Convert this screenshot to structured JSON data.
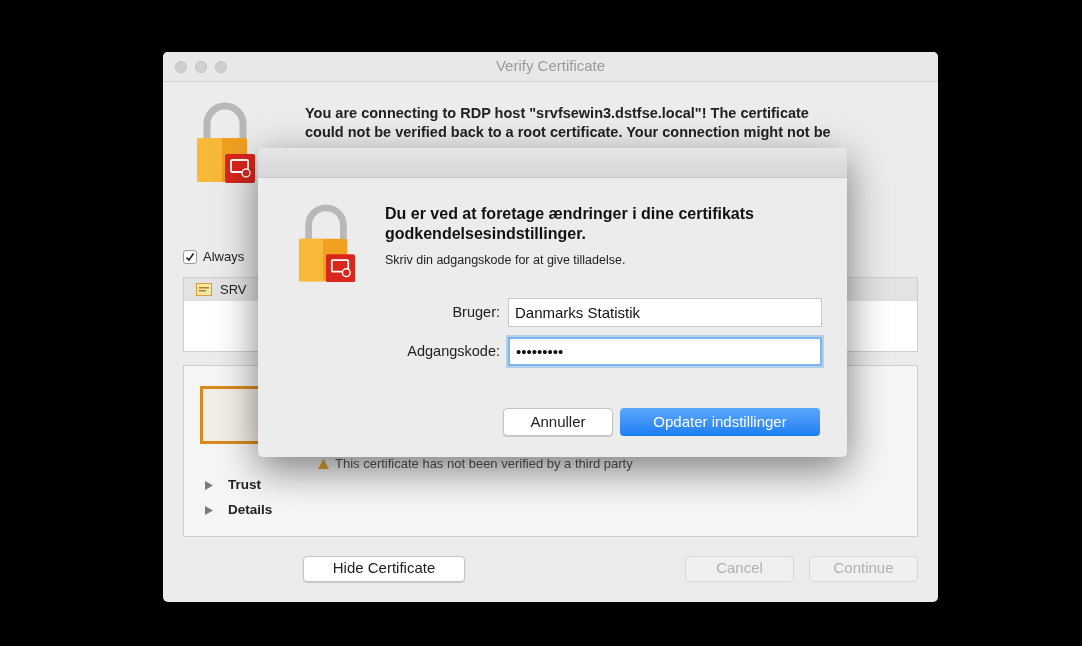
{
  "window": {
    "title": "Verify Certificate"
  },
  "message_lines": [
    "You are connecting to RDP host \"srvfsewin3.dstfse.local\"! The certificate",
    "could not be verified back to a root certificate. Your connection might not be"
  ],
  "always_checkbox": {
    "label": "Always",
    "checked": true
  },
  "certificate_list": [
    {
      "label": "SRV",
      "selected": true
    }
  ],
  "certificate_panel": {
    "warning": "This certificate has not been verified by a third party",
    "disclosures": [
      {
        "label": "Trust",
        "expanded": false
      },
      {
        "label": "Details",
        "expanded": false
      }
    ]
  },
  "buttons": [
    {
      "label": "Hide Certificate",
      "disabled": false
    },
    {
      "label": "Cancel",
      "disabled": true
    },
    {
      "label": "Continue",
      "disabled": true
    }
  ],
  "dialog": {
    "heading": "Du er ved at foretage ændringer i dine certifikats godkendelsesindstillinger.",
    "subtext": "Skriv din adgangskode for at give tilladelse.",
    "fields": [
      {
        "label": "Bruger:",
        "value": "Danmarks Statistik",
        "focused": false
      },
      {
        "label": "Adgangskode:",
        "value": "•••••••••",
        "focused": true
      }
    ],
    "buttons": [
      {
        "label": "Annuller",
        "default": false
      },
      {
        "label": "Opdater indstillinger",
        "default": true
      }
    ]
  }
}
